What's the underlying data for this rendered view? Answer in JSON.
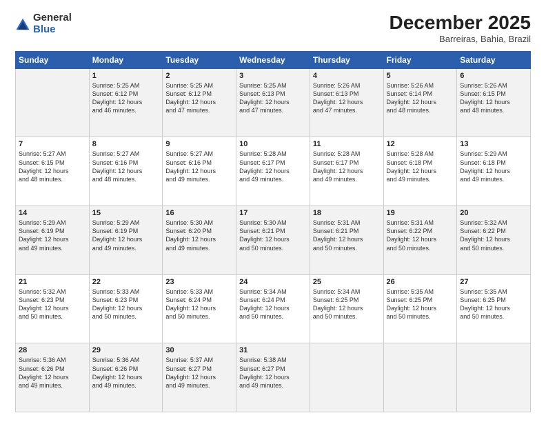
{
  "logo": {
    "general": "General",
    "blue": "Blue"
  },
  "header": {
    "month": "December 2025",
    "location": "Barreiras, Bahia, Brazil"
  },
  "weekdays": [
    "Sunday",
    "Monday",
    "Tuesday",
    "Wednesday",
    "Thursday",
    "Friday",
    "Saturday"
  ],
  "weeks": [
    [
      {
        "day": "",
        "info": ""
      },
      {
        "day": "1",
        "info": "Sunrise: 5:25 AM\nSunset: 6:12 PM\nDaylight: 12 hours\nand 46 minutes."
      },
      {
        "day": "2",
        "info": "Sunrise: 5:25 AM\nSunset: 6:12 PM\nDaylight: 12 hours\nand 47 minutes."
      },
      {
        "day": "3",
        "info": "Sunrise: 5:25 AM\nSunset: 6:13 PM\nDaylight: 12 hours\nand 47 minutes."
      },
      {
        "day": "4",
        "info": "Sunrise: 5:26 AM\nSunset: 6:13 PM\nDaylight: 12 hours\nand 47 minutes."
      },
      {
        "day": "5",
        "info": "Sunrise: 5:26 AM\nSunset: 6:14 PM\nDaylight: 12 hours\nand 48 minutes."
      },
      {
        "day": "6",
        "info": "Sunrise: 5:26 AM\nSunset: 6:15 PM\nDaylight: 12 hours\nand 48 minutes."
      }
    ],
    [
      {
        "day": "7",
        "info": "Sunrise: 5:27 AM\nSunset: 6:15 PM\nDaylight: 12 hours\nand 48 minutes."
      },
      {
        "day": "8",
        "info": "Sunrise: 5:27 AM\nSunset: 6:16 PM\nDaylight: 12 hours\nand 48 minutes."
      },
      {
        "day": "9",
        "info": "Sunrise: 5:27 AM\nSunset: 6:16 PM\nDaylight: 12 hours\nand 49 minutes."
      },
      {
        "day": "10",
        "info": "Sunrise: 5:28 AM\nSunset: 6:17 PM\nDaylight: 12 hours\nand 49 minutes."
      },
      {
        "day": "11",
        "info": "Sunrise: 5:28 AM\nSunset: 6:17 PM\nDaylight: 12 hours\nand 49 minutes."
      },
      {
        "day": "12",
        "info": "Sunrise: 5:28 AM\nSunset: 6:18 PM\nDaylight: 12 hours\nand 49 minutes."
      },
      {
        "day": "13",
        "info": "Sunrise: 5:29 AM\nSunset: 6:18 PM\nDaylight: 12 hours\nand 49 minutes."
      }
    ],
    [
      {
        "day": "14",
        "info": "Sunrise: 5:29 AM\nSunset: 6:19 PM\nDaylight: 12 hours\nand 49 minutes."
      },
      {
        "day": "15",
        "info": "Sunrise: 5:29 AM\nSunset: 6:19 PM\nDaylight: 12 hours\nand 49 minutes."
      },
      {
        "day": "16",
        "info": "Sunrise: 5:30 AM\nSunset: 6:20 PM\nDaylight: 12 hours\nand 49 minutes."
      },
      {
        "day": "17",
        "info": "Sunrise: 5:30 AM\nSunset: 6:21 PM\nDaylight: 12 hours\nand 50 minutes."
      },
      {
        "day": "18",
        "info": "Sunrise: 5:31 AM\nSunset: 6:21 PM\nDaylight: 12 hours\nand 50 minutes."
      },
      {
        "day": "19",
        "info": "Sunrise: 5:31 AM\nSunset: 6:22 PM\nDaylight: 12 hours\nand 50 minutes."
      },
      {
        "day": "20",
        "info": "Sunrise: 5:32 AM\nSunset: 6:22 PM\nDaylight: 12 hours\nand 50 minutes."
      }
    ],
    [
      {
        "day": "21",
        "info": "Sunrise: 5:32 AM\nSunset: 6:23 PM\nDaylight: 12 hours\nand 50 minutes."
      },
      {
        "day": "22",
        "info": "Sunrise: 5:33 AM\nSunset: 6:23 PM\nDaylight: 12 hours\nand 50 minutes."
      },
      {
        "day": "23",
        "info": "Sunrise: 5:33 AM\nSunset: 6:24 PM\nDaylight: 12 hours\nand 50 minutes."
      },
      {
        "day": "24",
        "info": "Sunrise: 5:34 AM\nSunset: 6:24 PM\nDaylight: 12 hours\nand 50 minutes."
      },
      {
        "day": "25",
        "info": "Sunrise: 5:34 AM\nSunset: 6:25 PM\nDaylight: 12 hours\nand 50 minutes."
      },
      {
        "day": "26",
        "info": "Sunrise: 5:35 AM\nSunset: 6:25 PM\nDaylight: 12 hours\nand 50 minutes."
      },
      {
        "day": "27",
        "info": "Sunrise: 5:35 AM\nSunset: 6:25 PM\nDaylight: 12 hours\nand 50 minutes."
      }
    ],
    [
      {
        "day": "28",
        "info": "Sunrise: 5:36 AM\nSunset: 6:26 PM\nDaylight: 12 hours\nand 49 minutes."
      },
      {
        "day": "29",
        "info": "Sunrise: 5:36 AM\nSunset: 6:26 PM\nDaylight: 12 hours\nand 49 minutes."
      },
      {
        "day": "30",
        "info": "Sunrise: 5:37 AM\nSunset: 6:27 PM\nDaylight: 12 hours\nand 49 minutes."
      },
      {
        "day": "31",
        "info": "Sunrise: 5:38 AM\nSunset: 6:27 PM\nDaylight: 12 hours\nand 49 minutes."
      },
      {
        "day": "",
        "info": ""
      },
      {
        "day": "",
        "info": ""
      },
      {
        "day": "",
        "info": ""
      }
    ]
  ]
}
